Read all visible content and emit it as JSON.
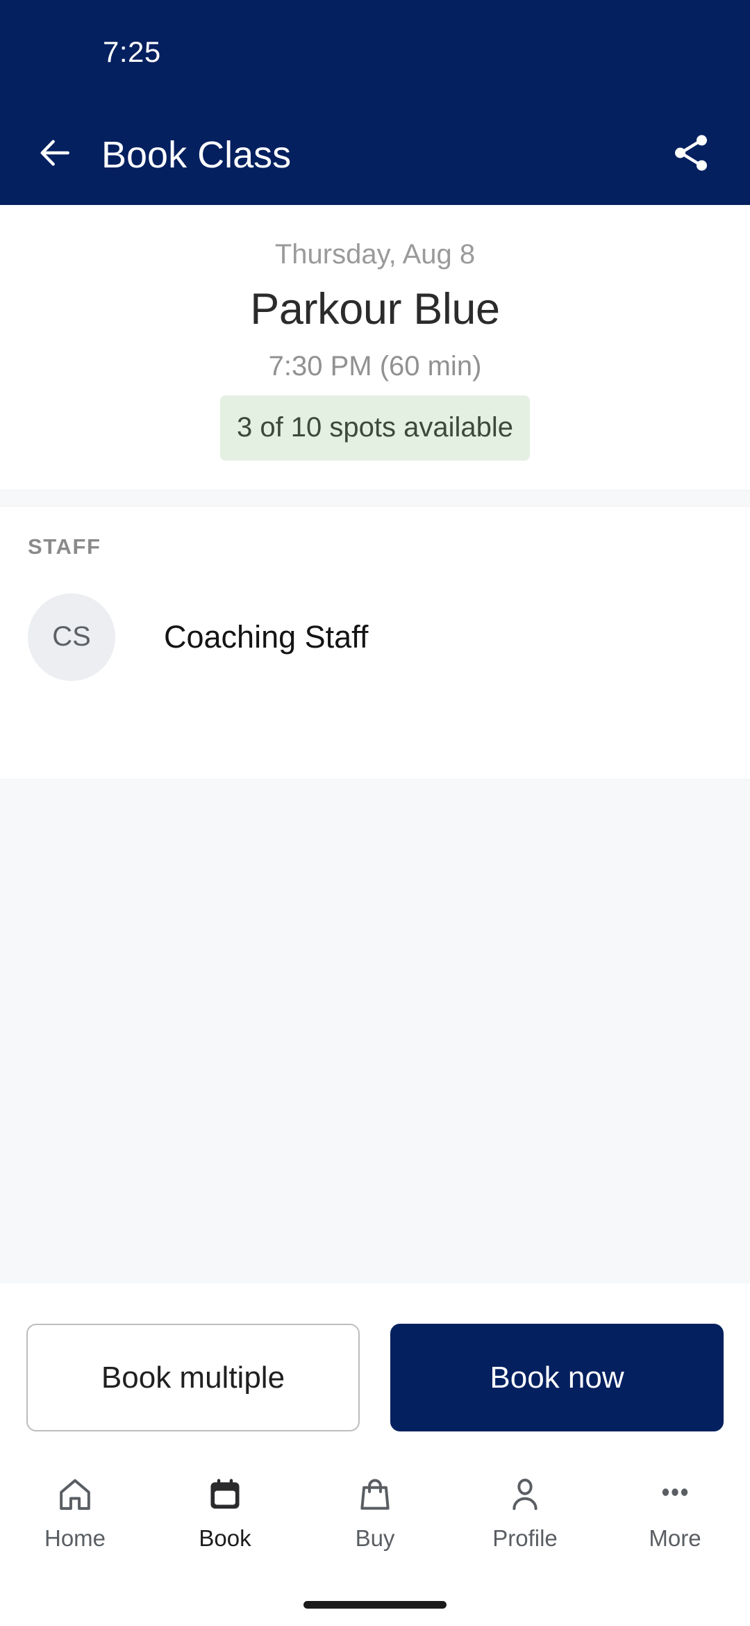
{
  "status_bar": {
    "time": "7:25"
  },
  "app_bar": {
    "title": "Book Class",
    "back_icon": "arrow-left-icon",
    "share_icon": "share-icon"
  },
  "class_summary": {
    "date": "Thursday, Aug 8",
    "name": "Parkour Blue",
    "time": "7:30 PM (60 min)",
    "availability": "3 of 10 spots available"
  },
  "staff_section": {
    "label": "STAFF",
    "members": [
      {
        "initials": "CS",
        "name": "Coaching Staff"
      }
    ]
  },
  "actions": {
    "secondary_label": "Book multiple",
    "primary_label": "Book now"
  },
  "bottom_nav": {
    "items": [
      {
        "label": "Home",
        "icon": "home-icon",
        "active": false
      },
      {
        "label": "Book",
        "icon": "calendar-icon",
        "active": true
      },
      {
        "label": "Buy",
        "icon": "shopping-bag-icon",
        "active": false
      },
      {
        "label": "Profile",
        "icon": "person-icon",
        "active": false
      },
      {
        "label": "More",
        "icon": "ellipsis-icon",
        "active": false
      }
    ]
  },
  "colors": {
    "brand_navy": "#04205f",
    "badge_green_bg": "#e4f0e2",
    "badge_green_text": "#3b4a3a",
    "page_gray": "#f6f8fa",
    "muted_text": "#9a9a9a"
  }
}
